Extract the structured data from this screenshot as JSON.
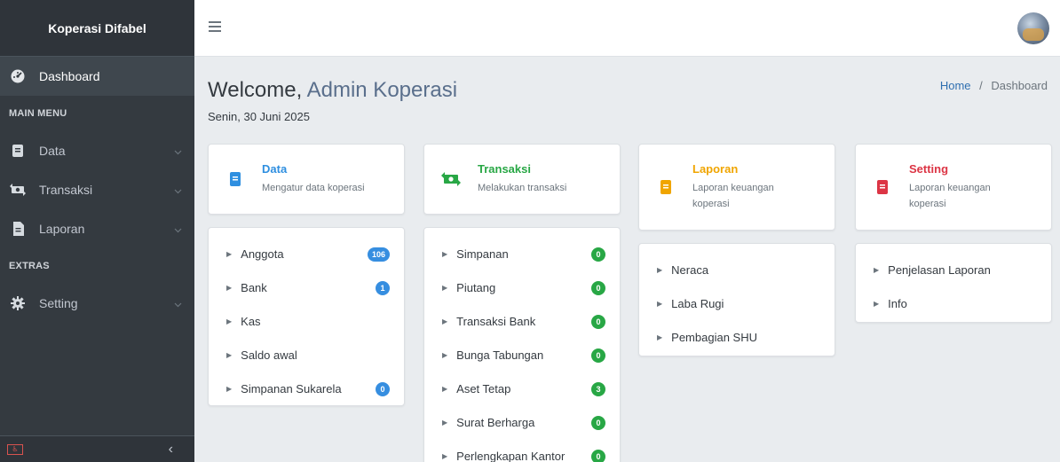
{
  "sidebar": {
    "brand": "Koperasi Difabel",
    "dashboard_label": "Dashboard",
    "main_menu_header": "MAIN MENU",
    "items": [
      {
        "label": "Data"
      },
      {
        "label": "Transaksi"
      },
      {
        "label": "Laporan"
      }
    ],
    "extras_header": "EXTRAS",
    "setting_label": "Setting",
    "collapse_icon": "chevron-left-icon"
  },
  "header": {
    "menu_icon": "hamburger-icon",
    "avatar": "user-avatar"
  },
  "main": {
    "welcome_prefix": "Welcome,",
    "welcome_name": "Admin Koperasi",
    "date": "Senin, 30 Juni 2025",
    "breadcrumb": {
      "home": "Home",
      "separator": "/",
      "current": "Dashboard"
    }
  },
  "cards": [
    {
      "title": "Data",
      "subtitle": "Mengatur data koperasi",
      "color": "#2f8fe0",
      "icon": "book-icon",
      "items": [
        {
          "label": "Anggota",
          "badge": "106",
          "badge_color": "blue"
        },
        {
          "label": "Bank",
          "badge": "1",
          "badge_color": "blue"
        },
        {
          "label": "Kas",
          "badge": "",
          "badge_color": ""
        },
        {
          "label": "Saldo awal",
          "badge": "",
          "badge_color": ""
        },
        {
          "label": "Simpanan Sukarela",
          "badge": "0",
          "badge_color": "blue"
        }
      ]
    },
    {
      "title": "Transaksi",
      "subtitle": "Melakukan transaksi",
      "color": "#28a745",
      "icon": "money-exchange-icon",
      "items": [
        {
          "label": "Simpanan",
          "badge": "0",
          "badge_color": "green"
        },
        {
          "label": "Piutang",
          "badge": "0",
          "badge_color": "green"
        },
        {
          "label": "Transaksi Bank",
          "badge": "0",
          "badge_color": "green"
        },
        {
          "label": "Bunga Tabungan",
          "badge": "0",
          "badge_color": "green"
        },
        {
          "label": "Aset Tetap",
          "badge": "3",
          "badge_color": "green"
        },
        {
          "label": "Surat Berharga",
          "badge": "0",
          "badge_color": "green"
        },
        {
          "label": "Perlengkapan Kantor",
          "badge": "0",
          "badge_color": "green"
        }
      ]
    },
    {
      "title": "Laporan",
      "subtitle": "Laporan keuangan koperasi",
      "color": "#f0a500",
      "icon": "book-icon",
      "items": [
        {
          "label": "Neraca"
        },
        {
          "label": "Laba Rugi"
        },
        {
          "label": "Pembagian SHU"
        }
      ]
    },
    {
      "title": "Setting",
      "subtitle": "Laporan keuangan koperasi",
      "color": "#dc3545",
      "icon": "book-icon",
      "items": [
        {
          "label": "Penjelasan Laporan"
        },
        {
          "label": "Info"
        }
      ]
    }
  ]
}
